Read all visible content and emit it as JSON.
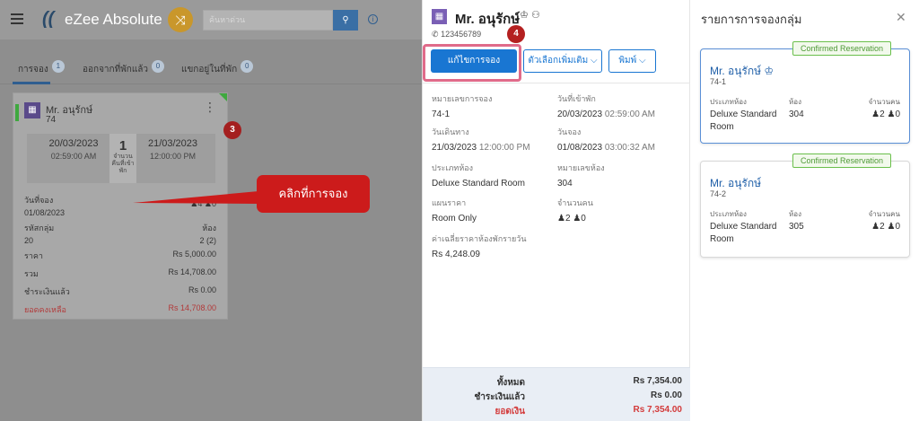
{
  "app": {
    "logo": "eZee Absolute",
    "search_placeholder": "ค้นหาด่วน"
  },
  "tabs": [
    {
      "label": "การจอง",
      "count": "1"
    },
    {
      "label": "ออกจากที่พักแล้ว",
      "count": "0"
    },
    {
      "label": "แขกอยู่ในที่พัก",
      "count": "0"
    }
  ],
  "card": {
    "name": "Mr. อนุรักษ์",
    "number": "74",
    "checkin_date": "20/03/2023",
    "checkin_time": "02:59:00 AM",
    "nights": "1",
    "nights_label": "จำนวนคืนที่เข้าพัก",
    "checkout_date": "21/03/2023",
    "checkout_time": "12:00:00 PM",
    "booking_date_label": "วันที่จอง",
    "booking_date": "01/08/2023",
    "guests_partial": "4",
    "kids": "0",
    "group_code_label": "รหัสกลุ่ม",
    "group_code": "20",
    "rooms_label": "ห้อง",
    "rooms": "2 (2)",
    "price_label": "ราคา",
    "price": "Rs 5,000.00",
    "total_label": "รวม",
    "total": "Rs 14,708.00",
    "paid_label": "ชำระเงินแล้ว",
    "paid": "Rs 0.00",
    "balance_label": "ยอดคงเหลือ",
    "balance": "Rs 14,708.00"
  },
  "annotations": {
    "step3": "3",
    "callout": "คลิกที่การจอง",
    "step4": "4"
  },
  "detail": {
    "name": "Mr. อนุรักษ์",
    "phone": "123456789",
    "edit_button": "แก้ไขการจอง",
    "options_button": "ตัวเลือกเพิ่มเติม",
    "print_button": "พิมพ์",
    "fields": {
      "res_no_label": "หมายเลขการจอง",
      "res_no": "74-1",
      "arrival_label": "วันที่เข้าพัก",
      "arrival_date": "20/03/2023",
      "arrival_time": "02:59:00 AM",
      "departure_label": "วันเดินทาง",
      "departure_date": "21/03/2023",
      "departure_time": "12:00:00 PM",
      "booking_label": "วันจอง",
      "booking_date": "01/08/2023",
      "booking_time": "03:00:32 AM",
      "room_type_label": "ประเภทห้อง",
      "room_type": "Deluxe Standard Room",
      "room_no_label": "หมายเลขห้อง",
      "room_no": "304",
      "rate_plan_label": "แผนราคา",
      "rate_plan": "Room Only",
      "pax_label": "จำนวนคน",
      "adults": "2",
      "children": "0",
      "avg_rate_label": "ค่าเฉลี่ยราคาห้องพักรายวัน",
      "avg_rate": "Rs 4,248.09"
    },
    "footer": {
      "total_label": "ทั้งหมด",
      "total": "Rs 7,354.00",
      "paid_label": "ชำระเงินแล้ว",
      "paid": "Rs 0.00",
      "due_label": "ยอดเงิน",
      "due": "Rs 7,354.00"
    }
  },
  "group": {
    "title": "รายการการจองกลุ่ม",
    "col_room_type": "ประเภทห้อง",
    "col_room": "ห้อง",
    "col_pax": "จำนวนคน",
    "items": [
      {
        "status": "Confirmed Reservation",
        "name": "Mr. อนุรักษ์",
        "number": "74-1",
        "room_type_line1": "Deluxe Standard",
        "room_type_line2": "Room",
        "room": "304",
        "adults": "2",
        "children": "0"
      },
      {
        "status": "Confirmed Reservation",
        "name": "Mr. อนุรักษ์",
        "number": "74-2",
        "room_type_line1": "Deluxe Standard",
        "room_type_line2": "Room",
        "room": "305",
        "adults": "2",
        "children": "0"
      }
    ]
  },
  "colors": {
    "primary": "#1976d2",
    "confirmed": "#4e9a36",
    "danger": "#d33a3a",
    "annotation_red": "#cc1b1b"
  }
}
